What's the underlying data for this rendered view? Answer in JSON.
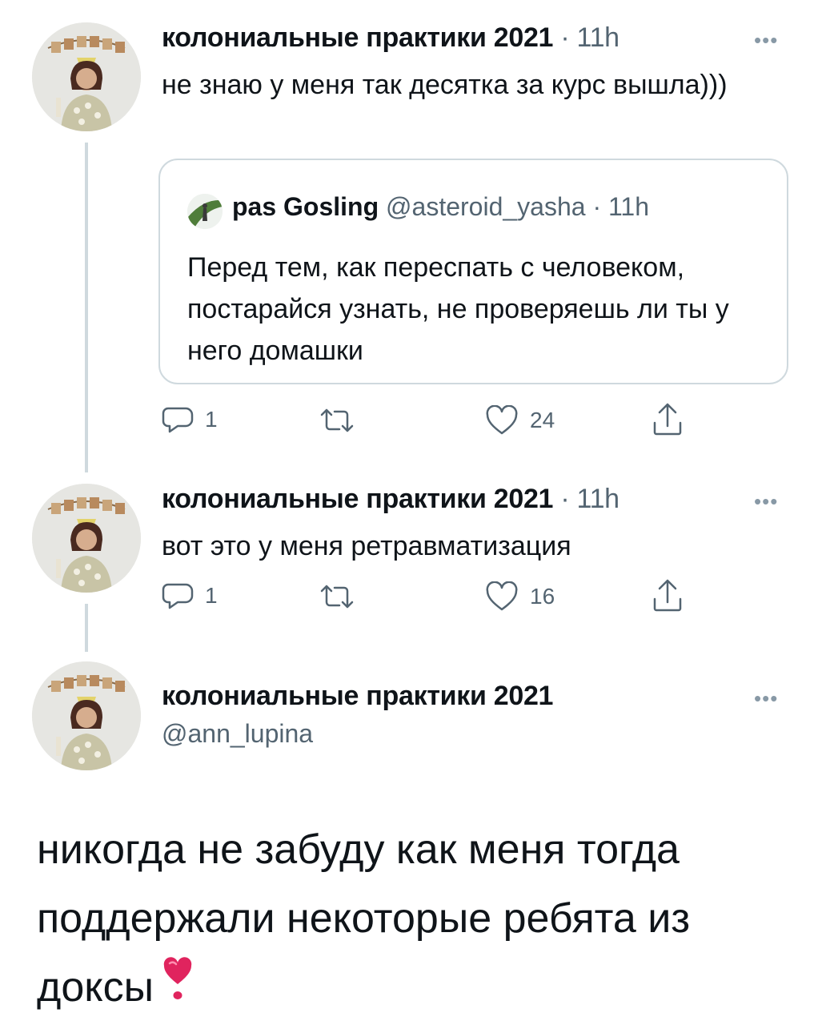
{
  "tweets": [
    {
      "author": "колониальные практики 2021",
      "time": " · 11h",
      "text": "не знаю у меня так десятка за курс вышла)))",
      "quote": {
        "author": "pas Gosling",
        "handle": " @asteroid_yasha · 11h",
        "text": "Перед тем, как переспать с человеком, постарайся узнать, не проверяешь ли ты у него домашки"
      },
      "replies": "1",
      "likes": "24"
    },
    {
      "author": "колониальные практики 2021",
      "time": " · 11h",
      "text": "вот это у меня ретравматизация",
      "replies": "1",
      "likes": "16"
    }
  ],
  "main_tweet": {
    "author": "колониальные практики 2021",
    "handle": "@ann_lupina",
    "text": "никогда не забуду как меня тогда поддержали некоторые ребята из доксы"
  },
  "more_label": "•••",
  "emoji": "heart-exclamation-icon",
  "colors": {
    "text": "#0f1419",
    "secondary": "#536471",
    "border": "#cfd9de",
    "heart": "#e0245e"
  }
}
